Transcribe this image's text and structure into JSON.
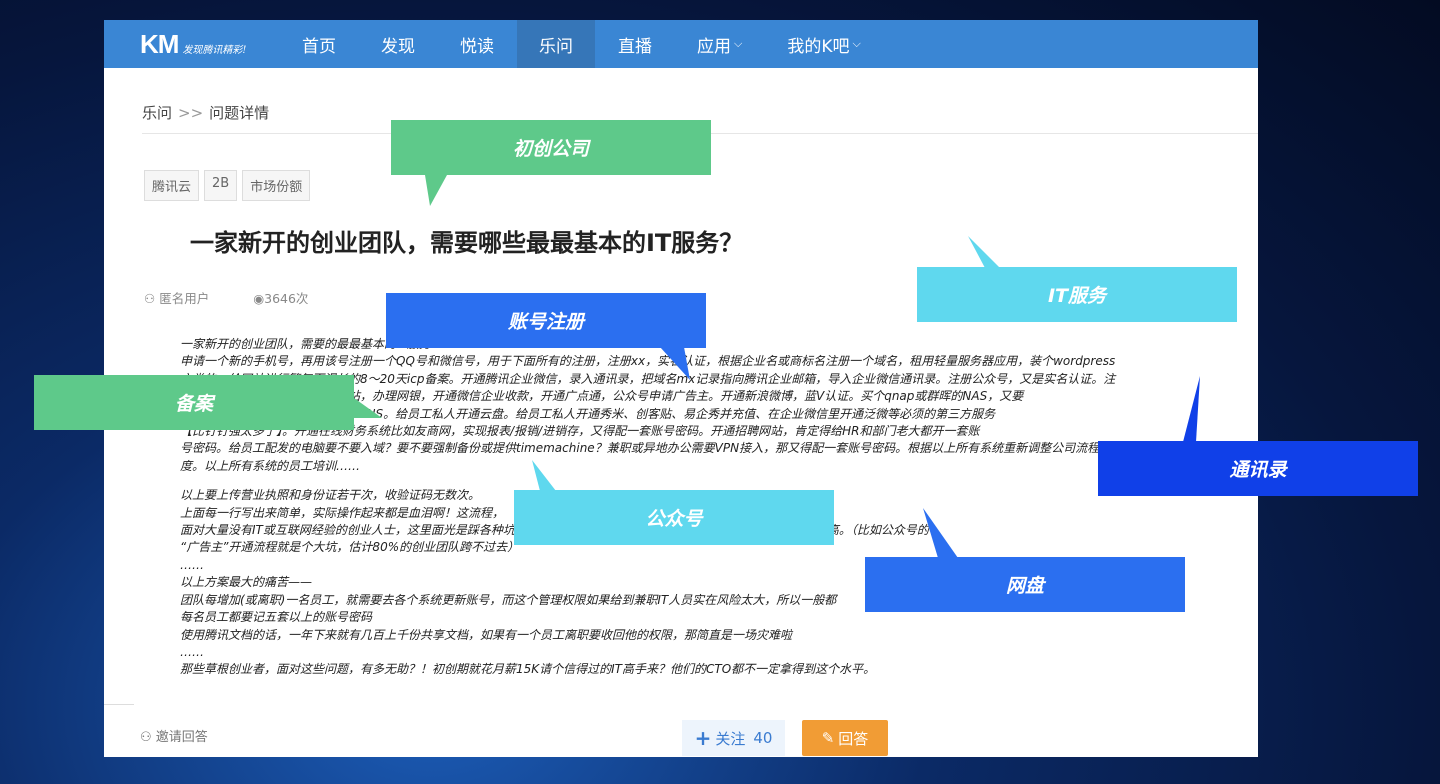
{
  "nav": {
    "logo": "KM",
    "logo_slogan": "发现腾讯精彩!",
    "items": [
      "首页",
      "发现",
      "悦读",
      "乐问",
      "直播",
      "应用",
      "我的K吧"
    ],
    "active": "乐问"
  },
  "breadcrumb": {
    "root": "乐问",
    "sep": ">>",
    "current": "问题详情"
  },
  "tags": [
    "腾讯云",
    "2B",
    "市场份额"
  ],
  "question": {
    "title": "一家新开的创业团队，需要哪些最最基本的IT服务？",
    "author": "匿名用户",
    "views": "3646次"
  },
  "body": [
    "一家新开的创业团队，需要的最最基本的IT服务",
    "申请一个新的手机号，再用该号注册一个QQ号和微信号，用于下面所有的注册，注册xx，实名认证，根据企业名或商标名注册一个域名，租用轻量服务器应用，装个wordpress",
    "之类的，给网站进行繁复而漫长的8～20天icp备案。开通腾讯企业微信，录入通讯录，把域名mx记录指向腾讯企业邮箱，导入企业微信通讯录。注册公众号，又是实名认证。注",
    "册微信支付，捆绑到公众号和网站，办理网银，开通微信企业收款，开通广点通，公众号申请广告主。开通新浪微博，蓝V认证。买个qnap或群晖的NAS，又要",
    "买个路由器，远程访问还要申请DDNS。给员工私人开通云盘。给员工私人开通秀米、创客贴、易企秀并充值、在企业微信里开通泛微等必须的第三方服务",
    "【比钉钉强太多了】。开通在线财务系统比如友商网，实现报表/报销/进销存，又得配一套账号密码。开通招聘网站，肯定得给HR和部门老大都开一套账",
    "号密码。给员工配发的电脑要不要入域？要不要强制备份或提供timemachine？兼职或异地办公需要VPN接入，那又得配一套账号密码。根据以上所有系统重新调整公司流程和制",
    "度。以上所有系统的员工培训……",
    "",
    "以上要上传营业执照和身份证若干次，收验证码无数次。",
    "上面每一行写出来简单，实际操作起来都是血泪啊！这流程，",
    "面对大量没有IT或互联网经验的创业人士，这里面光是踩各种坑就已经够受了，一旦决策了，资料录入以后的迁移成本也极高。（比如公众号的",
    "“广告主”开通流程就是个大坑，估计80%的创业团队跨不过去）",
    "……",
    "以上方案最大的痛苦——",
    "团队每增加(或离职)一名员工，就需要去各个系统更新账号，而这个管理权限如果给到兼职IT人员实在风险太大，所以一般都",
    "每名员工都要记五套以上的账号密码",
    "使用腾讯文档的话，一年下来就有几百上千份共享文档，如果有一个员工离职要收回他的权限，那简直是一场灾难啦",
    "……",
    "那些草根创业者，面对这些问题，有多无助？！初创期就花月薪15K请个信得过的IT高手来？他们的CTO都不一定拿得到这个水平。"
  ],
  "footer": {
    "invite": "邀请回答",
    "follow": "关注",
    "follow_count": "40",
    "answer": "回答"
  },
  "callouts": {
    "startup": "初创公司",
    "it_service": "IT服务",
    "account": "账号注册",
    "icp": "备案",
    "contacts": "通讯录",
    "official": "公众号",
    "netdisk": "网盘"
  },
  "colors": {
    "green": "#5ec98a",
    "cyan": "#5fd8ee",
    "blue": "#2b6ff0",
    "deep_blue": "#1040e8",
    "nav": "#3a86d4",
    "orange": "#f19c35"
  }
}
